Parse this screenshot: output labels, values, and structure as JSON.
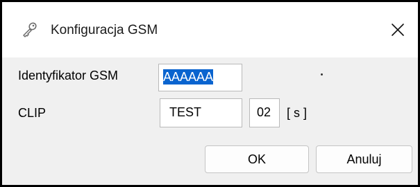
{
  "dialog": {
    "title": "Konfiguracja GSM",
    "title_icon": "key-icon",
    "close_icon": "close-icon"
  },
  "form": {
    "gsm_id_label": "Identyfikator GSM",
    "gsm_id_value": "AAAAAA",
    "clip_label": "CLIP",
    "clip_value": "TEST",
    "clip_interval_value": "02",
    "clip_interval_unit": "[ s ]"
  },
  "buttons": {
    "ok_label": "OK",
    "cancel_label": "Anuluj"
  },
  "colors": {
    "selection": "#0a64cf",
    "dialog_background": "#f0f0f0",
    "titlebar_background": "#ffffff"
  }
}
